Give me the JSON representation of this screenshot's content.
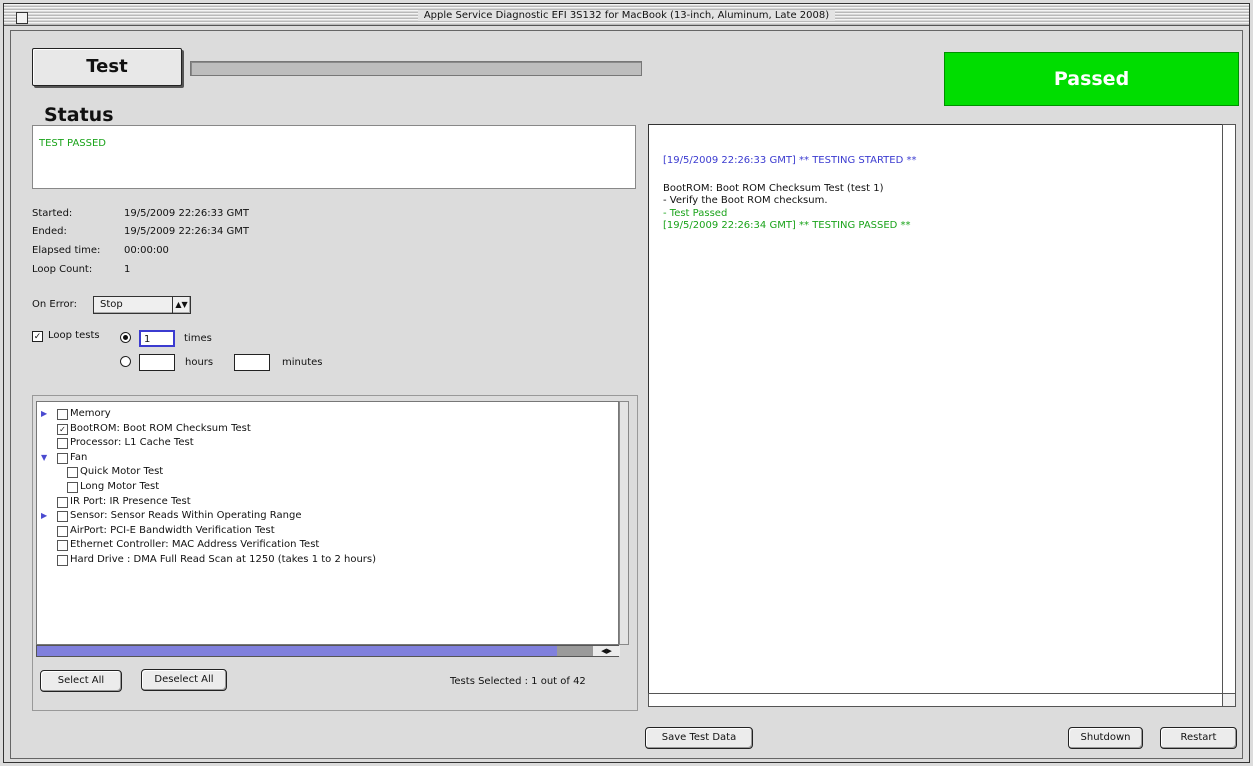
{
  "window": {
    "title": "Apple Service Diagnostic EFI 3S132 for MacBook (13-inch, Aluminum, Late 2008)"
  },
  "header": {
    "test_label": "Test",
    "result": "Passed",
    "result_color": "#00dd00"
  },
  "status": {
    "heading": "Status",
    "message": "TEST PASSED",
    "started_label": "Started:",
    "started_value": "19/5/2009 22:26:33 GMT",
    "ended_label": "Ended:",
    "ended_value": "19/5/2009 22:26:34 GMT",
    "elapsed_label": "Elapsed time:",
    "elapsed_value": "00:00:00",
    "loop_label": "Loop Count:",
    "loop_value": "1"
  },
  "controls": {
    "on_error_label": "On Error:",
    "on_error_value": "Stop",
    "loop_tests_label": "Loop tests",
    "loop_times_value": "1",
    "times_label": "times",
    "hours_value": "",
    "hours_label": "hours",
    "minutes_value": "",
    "minutes_label": "minutes"
  },
  "tests": [
    {
      "label": "Memory",
      "checked": false,
      "triangle": "right",
      "indent": 0
    },
    {
      "label": "BootROM: Boot ROM Checksum Test",
      "checked": true,
      "triangle": "",
      "indent": 0
    },
    {
      "label": "Processor: L1 Cache Test",
      "checked": false,
      "triangle": "",
      "indent": 0
    },
    {
      "label": "Fan",
      "checked": false,
      "triangle": "down",
      "indent": 0
    },
    {
      "label": "Quick Motor Test",
      "checked": false,
      "triangle": "",
      "indent": 1
    },
    {
      "label": "Long Motor Test",
      "checked": false,
      "triangle": "",
      "indent": 1
    },
    {
      "label": "IR Port: IR Presence Test",
      "checked": false,
      "triangle": "",
      "indent": 0
    },
    {
      "label": "Sensor: Sensor Reads Within Operating Range",
      "checked": false,
      "triangle": "right",
      "indent": 0
    },
    {
      "label": "AirPort: PCI-E Bandwidth Verification Test",
      "checked": false,
      "triangle": "",
      "indent": 0
    },
    {
      "label": "Ethernet Controller: MAC Address Verification Test",
      "checked": false,
      "triangle": "",
      "indent": 0
    },
    {
      "label": "Hard Drive : DMA Full Read Scan at 1250 (takes 1 to 2 hours)",
      "checked": false,
      "triangle": "",
      "indent": 0
    }
  ],
  "list_buttons": {
    "select_all": "Select All",
    "deselect_all": "Deselect All"
  },
  "tests_selected": "Tests Selected : 1 out of 42",
  "log": [
    {
      "text": "[19/5/2009 22:26:33 GMT] ** TESTING STARTED **",
      "color": "blue"
    },
    {
      "text": "BootROM: Boot ROM Checksum Test (test 1)",
      "color": "black"
    },
    {
      "text": "- Verify the Boot ROM checksum.",
      "color": "black"
    },
    {
      "text": "- Test Passed",
      "color": "green"
    },
    {
      "text": "[19/5/2009 22:26:34 GMT] ** TESTING PASSED **",
      "color": "green"
    }
  ],
  "footer": {
    "save": "Save Test Data",
    "shutdown": "Shutdown",
    "restart": "Restart"
  }
}
